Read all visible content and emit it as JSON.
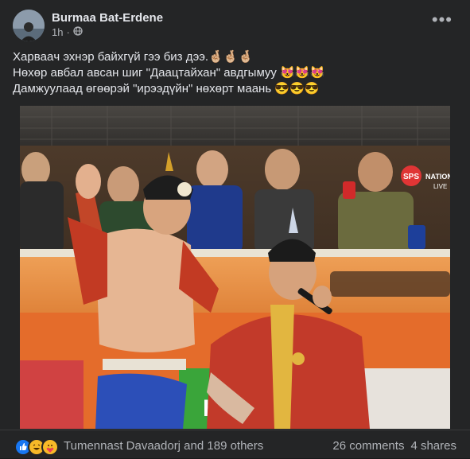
{
  "post": {
    "author": "Burmaa Bat-Erdene",
    "time": "1h",
    "privacy_icon": "globe-icon",
    "lines": [
      "Харвaaч эхнэр байхгүй гээ биз дээ.🤞🏼🤞🏼🤞🏼",
      "Нөхөр авбал авсан шиг \"Даацтайхан\" авдгымуу 😻😻😻",
      "Дамжуулаад өгөөрэй \"ирээдүйн\" нөхөрт маань 😎😎😎"
    ]
  },
  "photo": {
    "broadcast_logo": "SPS",
    "broadcast_sub": "NATION",
    "broadcast_live": "LIVE",
    "banner_text": "HI"
  },
  "footer": {
    "reaction_icons": [
      "like-icon",
      "haha-icon",
      "care-icon"
    ],
    "likers": "Tumennast Davaadorj and 189 others",
    "comments": "26 comments",
    "shares": "4 shares"
  },
  "colors": {
    "card_bg": "#242526",
    "text_primary": "#e4e6eb",
    "text_secondary": "#b0b3b8",
    "like_blue": "#1877f2",
    "haha_yellow": "#f7b928"
  }
}
